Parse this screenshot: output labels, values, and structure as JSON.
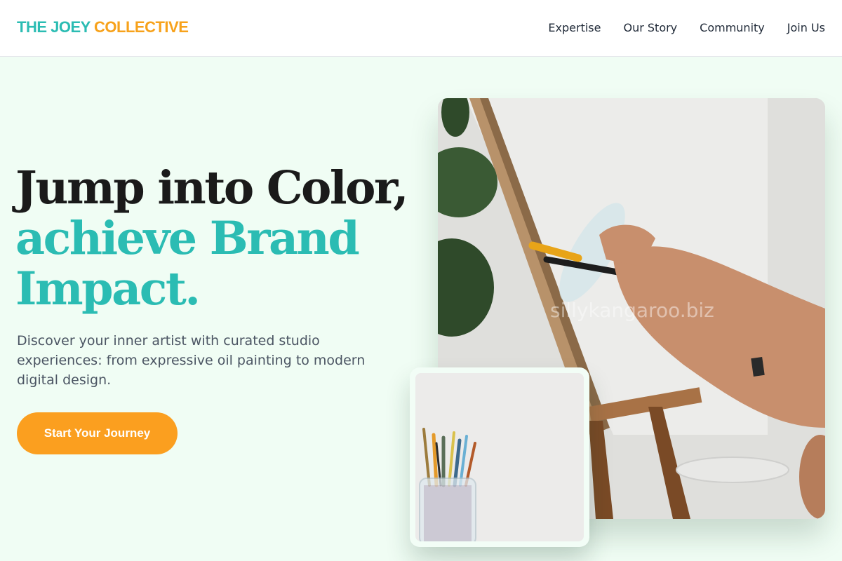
{
  "brand": {
    "part1": "THE JOEY",
    "part2": "COLLECTIVE"
  },
  "nav": {
    "items": [
      {
        "label": "Expertise"
      },
      {
        "label": "Our Story"
      },
      {
        "label": "Community"
      },
      {
        "label": "Join Us"
      }
    ]
  },
  "hero": {
    "headline_line1": "Jump into Color,",
    "headline_line2": "achieve Brand",
    "headline_line3": "Impact.",
    "subtitle": "Discover your inner artist with curated studio experiences: from expressive oil painting to modern digital design.",
    "cta_label": "Start Your Journey",
    "image_watermark": "sillykangaroo.biz"
  },
  "colors": {
    "accent_teal": "#2bbcb3",
    "accent_orange": "#fb9f1f",
    "background": "#f0fdf4",
    "heading_dark": "#1a1a1a",
    "body_text": "#4b5563"
  },
  "images": {
    "hero": "painting-on-easel-photo",
    "secondary": "brushes-in-jar-photo"
  }
}
